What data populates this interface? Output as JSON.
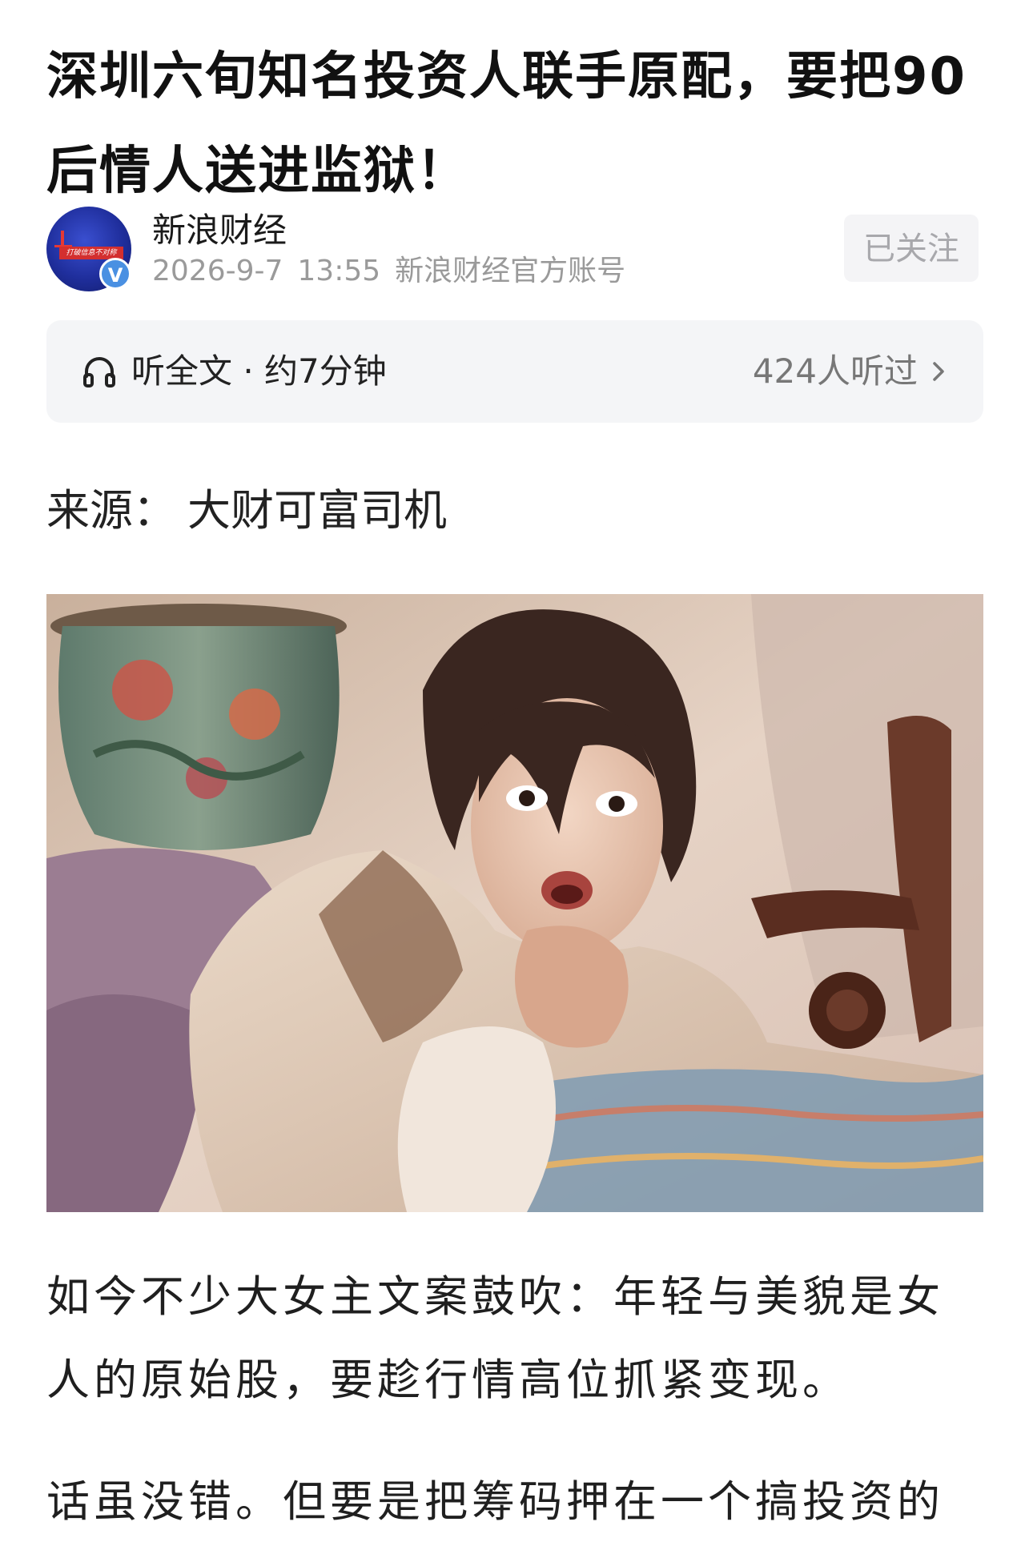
{
  "article": {
    "title": "深圳六旬知名投资人联手原配，要把90后情人送进监狱！"
  },
  "author": {
    "name": "新浪财经",
    "date": "2026-9-7",
    "time": "13:55",
    "account_type": "新浪财经官方账号",
    "follow_label": "已关注",
    "verified_badge": "V",
    "avatar_banner": "打破信息不对称"
  },
  "listen": {
    "label": "听全文 · 约7分钟",
    "count_text": "424人听过"
  },
  "source": {
    "label": "来源：",
    "value": "大财可富司机"
  },
  "paragraphs": [
    "如今不少大女主文案鼓吹：年轻与美貌是女人的原始股，要趁行情高位抓紧变现。",
    "话虽没错。但要是把筹码押在一个搞投资的老男人，首先要明白一件事：投资人掏出来"
  ],
  "icons": {
    "listen": "headphones-icon",
    "more": "chevron-right-icon",
    "verified": "verified-icon"
  },
  "colors": {
    "avatar_bg": "#1f2e9c",
    "verified": "#4a90e2",
    "listen_bar_bg": "#f4f5f7",
    "meta_text": "#9a9a9a"
  }
}
